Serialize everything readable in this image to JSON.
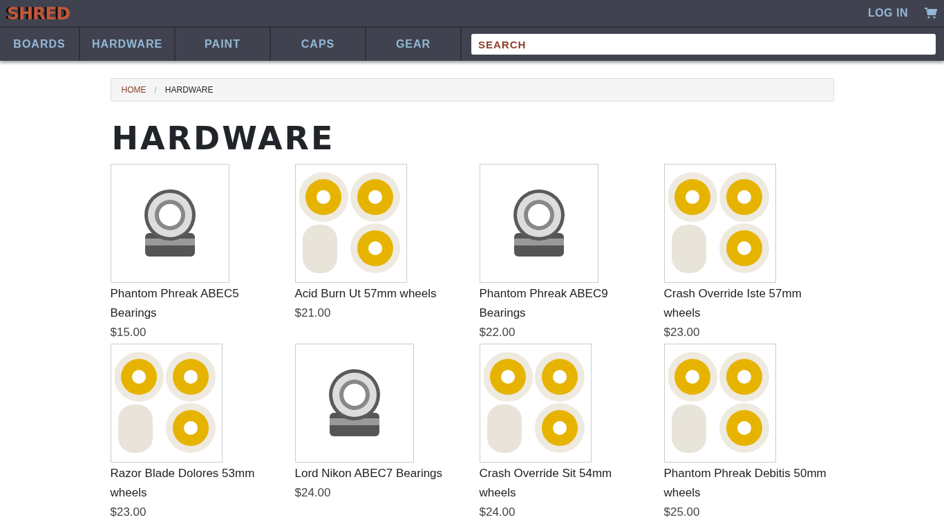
{
  "logo": "SHRED",
  "header": {
    "login": "LOG IN"
  },
  "nav": [
    {
      "label": "BOARDS",
      "selected": false
    },
    {
      "label": "HARDWARE",
      "selected": false
    },
    {
      "label": "PAINT",
      "selected": false
    },
    {
      "label": "CAPS",
      "selected": false
    },
    {
      "label": "GEAR",
      "selected": false
    }
  ],
  "search": {
    "placeholder": "SEARCH"
  },
  "breadcrumb": {
    "separator": "/",
    "items": [
      {
        "label": "HOME",
        "link": true
      },
      {
        "label": "HARDWARE",
        "link": false
      }
    ]
  },
  "page_title": "HARDWARE",
  "products": [
    {
      "kind": "bearings",
      "name": "Phantom Phreak ABEC5 Bearings",
      "price": "$15.00"
    },
    {
      "kind": "wheels",
      "name": "Acid Burn Ut 57mm wheels",
      "price": "$21.00"
    },
    {
      "kind": "bearings",
      "name": "Phantom Phreak ABEC9 Bearings",
      "price": "$22.00"
    },
    {
      "kind": "wheels",
      "name": "Crash Override Iste 57mm wheels",
      "price": "$23.00"
    },
    {
      "kind": "wheels",
      "name": "Razor Blade Dolores 53mm wheels",
      "price": "$23.00"
    },
    {
      "kind": "bearings",
      "name": "Lord Nikon ABEC7 Bearings",
      "price": "$24.00"
    },
    {
      "kind": "wheels",
      "name": "Crash Override Sit 54mm wheels",
      "price": "$24.00"
    },
    {
      "kind": "wheels",
      "name": "Phantom Phreak Debitis 50mm wheels",
      "price": "$25.00"
    }
  ]
}
